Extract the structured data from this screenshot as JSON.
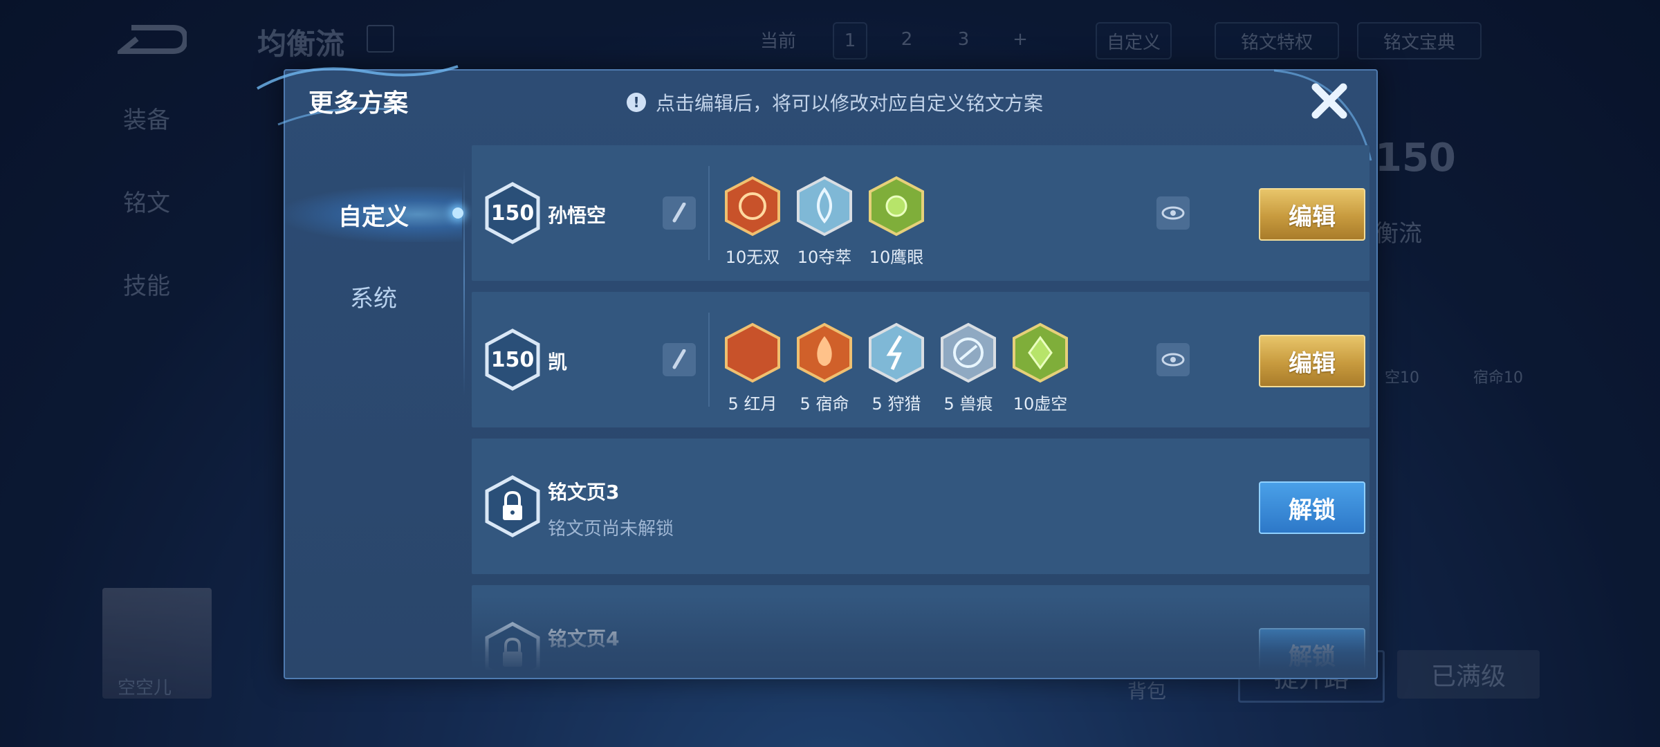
{
  "background": {
    "page_title": "均衡流",
    "current_label": "当前",
    "page_numbers": [
      "1",
      "2",
      "3",
      "+"
    ],
    "custom_label": "自定义",
    "privilege_label": "铭文特权",
    "codex_label": "铭文宝典",
    "side_menu": [
      "装备",
      "铭文",
      "技能"
    ],
    "level_badge": "150",
    "level_name": "衡流",
    "rune_labels": [
      "空10",
      "宿命10"
    ],
    "player_name": "空空儿",
    "bag_label": "背包",
    "upgrade_label": "提升路",
    "maxed_label": "已满级"
  },
  "modal": {
    "title": "更多方案",
    "hint_icon": "!",
    "hint": "点击编辑后，将可以修改对应自定义铭文方案",
    "close_icon": "close-icon"
  },
  "tabs": [
    {
      "label": "自定义",
      "active": true
    },
    {
      "label": "系统",
      "active": false
    }
  ],
  "pages": [
    {
      "level": "150",
      "hero": "孙悟空",
      "action": "编辑",
      "runes": [
        {
          "label": "10无双",
          "color": "#c8522a"
        },
        {
          "label": "10夺萃",
          "color": "#7fb8d6"
        },
        {
          "label": "10鹰眼",
          "color": "#7fae3a"
        }
      ]
    },
    {
      "level": "150",
      "hero": "凯",
      "action": "编辑",
      "runes": [
        {
          "label": "5 红月",
          "color": "#c8522a"
        },
        {
          "label": "5 宿命",
          "color": "#d0602a"
        },
        {
          "label": "5 狩猎",
          "color": "#7fb8d6"
        },
        {
          "label": "5 兽痕",
          "color": "#8fa9c2"
        },
        {
          "label": "10虚空",
          "color": "#7fae3a"
        }
      ]
    },
    {
      "title": "铭文页3",
      "subtitle": "铭文页尚未解锁",
      "action": "解锁"
    },
    {
      "title": "铭文页4",
      "action": "解锁"
    }
  ]
}
